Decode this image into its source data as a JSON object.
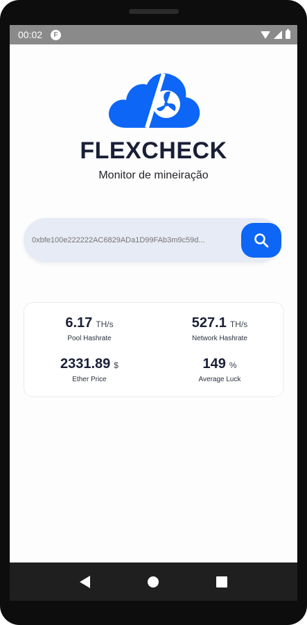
{
  "status_bar": {
    "time": "00:02",
    "app_icon_glyph": "F",
    "icons": [
      "wifi-icon",
      "signal-icon",
      "battery-icon"
    ]
  },
  "app": {
    "title": "FLEXCHECK",
    "subtitle": "Monitor de mineiração",
    "logo_icon": "cloud-fan-logo",
    "brand_color": "#0d66f5"
  },
  "search": {
    "placeholder": "0xbfe100e222222AC6829ADa1D99FAb3m9c59d...",
    "button_icon": "search-icon"
  },
  "stats": [
    {
      "value": "6.17",
      "unit": "TH/s",
      "label": "Pool Hashrate"
    },
    {
      "value": "527.1",
      "unit": "TH/s",
      "label": "Network Hashrate"
    },
    {
      "value": "2331.89",
      "unit": "$",
      "label": "Ether Price"
    },
    {
      "value": "149",
      "unit": "%",
      "label": "Average Luck"
    }
  ],
  "nav_bar": {
    "icons": [
      "back-icon",
      "home-icon",
      "recents-icon"
    ]
  }
}
